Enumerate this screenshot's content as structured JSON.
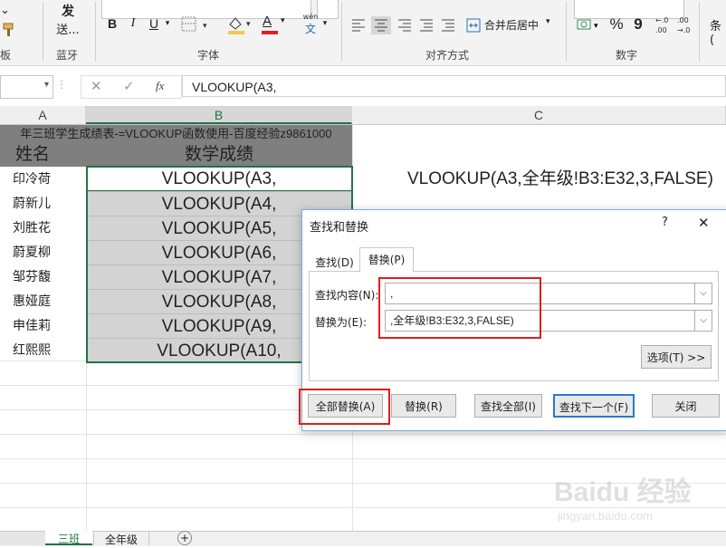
{
  "ribbon": {
    "left_label": "板",
    "send_label_1": "发",
    "send_label_2": "送...",
    "bluetooth_group": "蓝牙",
    "font_group": "字体",
    "align_group": "对齐方式",
    "number_group": "数字",
    "merge_label": "合并后居中",
    "wen_label": "wén",
    "wen_char": "文",
    "cond_label": "条(",
    "bold": "B",
    "italic": "I",
    "underline": "U",
    "font_color_letter": "A",
    "percent": "%",
    "comma": "9"
  },
  "formula_bar": {
    "fx": "fx",
    "content": "VLOOKUP(A3,"
  },
  "columns": [
    "A",
    "B",
    "C"
  ],
  "sheet": {
    "title_row": "年三班学生成绩表-=VLOOKUP函数使用-百度经验z9861000",
    "header_a": "姓名",
    "header_b": "数学成绩",
    "names": [
      "印冷荷",
      "蔚新儿",
      "刘胜花",
      "蔚夏柳",
      "邹芬馥",
      "惠娅庭",
      "申佳莉",
      "红熙熙"
    ],
    "formulas": [
      "VLOOKUP(A3,",
      "VLOOKUP(A4,",
      "VLOOKUP(A5,",
      "VLOOKUP(A6,",
      "VLOOKUP(A7,",
      "VLOOKUP(A8,",
      "VLOOKUP(A9,",
      "VLOOKUP(A10,"
    ],
    "c_text": "VLOOKUP(A3,全年级!B3:E32,3,FALSE)"
  },
  "dialog": {
    "title": "查找和替换",
    "help": "?",
    "close": "✕",
    "tab_find": "查找(D)",
    "tab_replace": "替换(P)",
    "find_label": "查找内容(N):",
    "find_value": ",",
    "replace_label": "替换为(E):",
    "replace_value": ",全年级!B3:E32,3,FALSE)",
    "options_btn": "选项(T) >>",
    "replace_all": "全部替换(A)",
    "replace": "替换(R)",
    "find_all": "查找全部(I)",
    "find_next": "查找下一个(F)",
    "close_btn": "关闭"
  },
  "tabs": {
    "tab1": "三班",
    "tab2": "全年级",
    "add": "+"
  },
  "watermark": {
    "brand": "Baidu 经验",
    "url": "jingyan.baidu.com"
  }
}
